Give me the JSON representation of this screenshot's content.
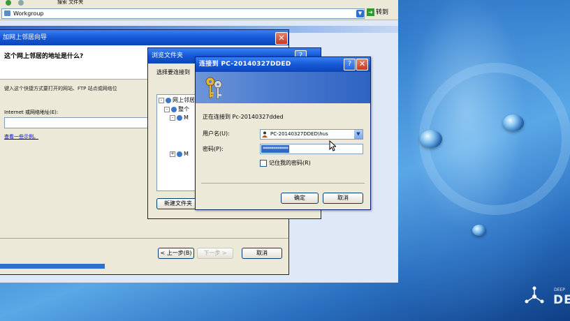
{
  "explorer": {
    "toolbar_text": "搜索  文件夹",
    "address": "Workgroup",
    "go_label": "转到"
  },
  "wizard": {
    "title": "加网上邻居向导",
    "question": "这个网上邻居的地址是什么?",
    "description": "键入这个快捷方式要打开的网站、FTP 站点或网络位",
    "address_label": "Internet 或网络地址(E):",
    "example_link": "查看一些示例。",
    "back_label": "< 上一步(B)",
    "next_label": "下一步 >",
    "cancel_label": "取消"
  },
  "browse": {
    "title": "浏览文件夹",
    "help": "?",
    "prompt": "选择要连接到",
    "tree": [
      "网上邻居",
      "整个",
      "M",
      "M"
    ],
    "new_folder_label": "新建文件夹"
  },
  "connect": {
    "title": "连接到 PC-20140327DDED",
    "help": "?",
    "close": "✕",
    "status": "正在连接到 Pc-20140327dded",
    "user_label": "用户名(U):",
    "user_value": "PC-20140327DDED\\hus",
    "password_label": "密码(P):",
    "password_value": "************",
    "remember_label": "记住我的密码(R)",
    "ok_label": "确定",
    "cancel_label": "取消"
  },
  "desktop": {
    "brand": "DE",
    "brand_small": "DEEP"
  }
}
